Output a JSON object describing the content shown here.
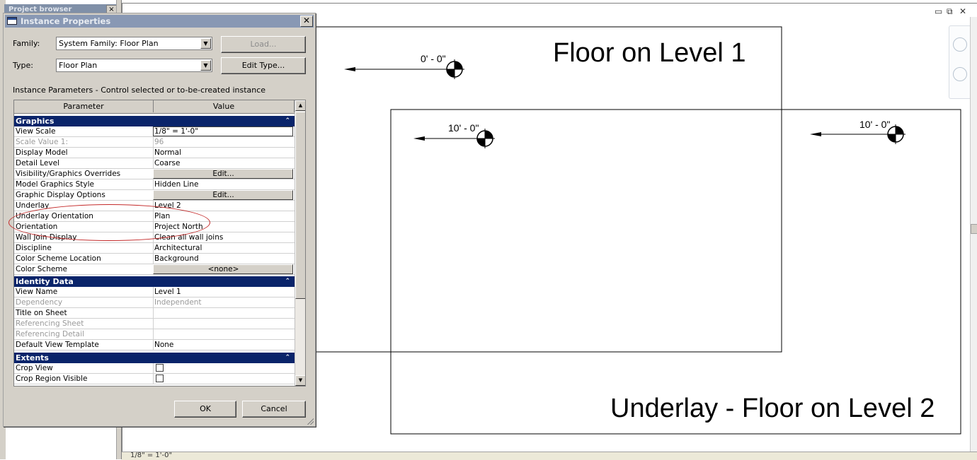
{
  "background": {
    "project_browser_title": "Project browser",
    "mdi_controls": {
      "minimize": "▭",
      "restore": "⧉",
      "close": "✕"
    },
    "status_bar": {
      "scale": "1/8\" = 1'-0\""
    }
  },
  "drawing": {
    "level1_label": "Floor on Level 1",
    "level2_label": "Underlay - Floor on Level 2",
    "elevation_markers": [
      "0' - 0\"",
      "10' - 0\"",
      "10' - 0\""
    ]
  },
  "dialog": {
    "title": "Instance Properties",
    "close_glyph": "✕",
    "family_label": "Family:",
    "family_value": "System Family: Floor Plan",
    "type_label": "Type:",
    "type_value": "Floor Plan",
    "load_button": "Load...",
    "edit_type_button": "Edit Type...",
    "description": "Instance Parameters - Control selected or to-be-created instance",
    "ok_button": "OK",
    "cancel_button": "Cancel"
  },
  "grid": {
    "col_parameter": "Parameter",
    "col_value": "Value",
    "groups": [
      {
        "name": "Graphics",
        "rows": [
          {
            "param": "View Scale",
            "value": "1/8\" = 1'-0\""
          },
          {
            "param": "Scale Value    1:",
            "value": "96"
          },
          {
            "param": "Display Model",
            "value": "Normal"
          },
          {
            "param": "Detail Level",
            "value": "Coarse"
          },
          {
            "param": "Visibility/Graphics Overrides",
            "value": "Edit..."
          },
          {
            "param": "Model Graphics Style",
            "value": "Hidden Line"
          },
          {
            "param": "Graphic Display Options",
            "value": "Edit..."
          },
          {
            "param": "Underlay",
            "value": "Level 2"
          },
          {
            "param": "Underlay Orientation",
            "value": "Plan"
          },
          {
            "param": "Orientation",
            "value": "Project North"
          },
          {
            "param": "Wall Join Display",
            "value": "Clean all wall joins"
          },
          {
            "param": "Discipline",
            "value": "Architectural"
          },
          {
            "param": "Color Scheme Location",
            "value": "Background"
          },
          {
            "param": "Color Scheme",
            "value": "<none>"
          }
        ]
      },
      {
        "name": "Identity Data",
        "rows": [
          {
            "param": "View Name",
            "value": "Level 1"
          },
          {
            "param": "Dependency",
            "value": "Independent"
          },
          {
            "param": "Title on Sheet",
            "value": ""
          },
          {
            "param": "Referencing Sheet",
            "value": ""
          },
          {
            "param": "Referencing Detail",
            "value": ""
          },
          {
            "param": "Default View Template",
            "value": "None"
          }
        ]
      },
      {
        "name": "Extents",
        "rows": [
          {
            "param": "Crop View",
            "value": ""
          },
          {
            "param": "Crop Region Visible",
            "value": ""
          }
        ]
      }
    ],
    "collapse_glyph": "⌃"
  },
  "colors": {
    "group_header": "#0a246a",
    "annotation": "#c42a2a",
    "dialog_bg": "#d4d0c8"
  }
}
